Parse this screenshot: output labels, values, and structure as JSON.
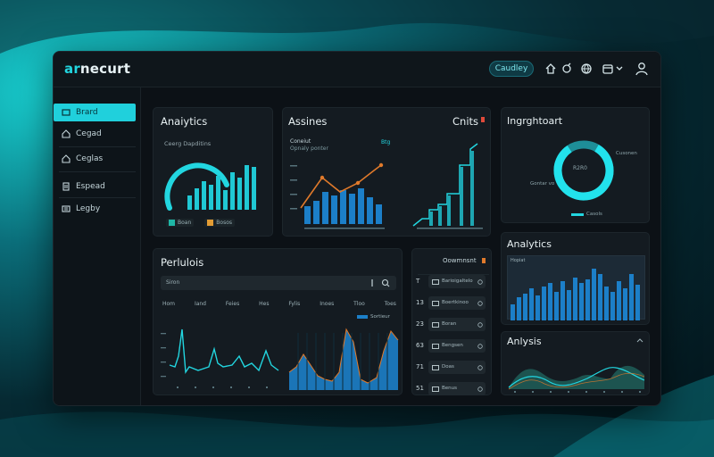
{
  "app": {
    "logo_prefix": "ar",
    "logo_suffix": "necurt",
    "top_button": "Caudley"
  },
  "sidebar": {
    "items": [
      {
        "label": "Brard",
        "icon": "dashboard-icon",
        "active": true
      },
      {
        "label": "Cegad",
        "icon": "home-icon"
      },
      {
        "label": "Ceglas",
        "icon": "home-icon"
      },
      {
        "label": "Espead",
        "icon": "document-icon"
      },
      {
        "label": "Legby",
        "icon": "list-icon"
      }
    ]
  },
  "panels": {
    "analytics_top": {
      "title": "Anaiytics",
      "subtitle": "Ceerg Dapditins",
      "legend": [
        {
          "label": "Boan",
          "color": "#1fb6a6"
        },
        {
          "label": "Bosos",
          "color": "#e39c34"
        }
      ]
    },
    "assines": {
      "title": "Assines",
      "subtitle": "Coneiut",
      "subtitle2": "Opnaly ponter",
      "badge": "Btg"
    },
    "cnits": {
      "title": "Cnits"
    },
    "ingrights": {
      "title": "Ingrghtoart",
      "center_label": "R2R0",
      "label_right": "Cusonen",
      "label_left": "Gontar vo",
      "legend": "Casols"
    },
    "perlulois": {
      "title": "Perlulois",
      "filter": "Siron",
      "columns": [
        "Hom",
        "Iand",
        "Feies",
        "Hes",
        "Fylis",
        "Inoes",
        "Tloo",
        "Toes"
      ],
      "legend": "Sortieur"
    },
    "list_panel": {
      "title": "Oowmnsnt",
      "rows": [
        {
          "num": "T",
          "label": "Barioigaltelo"
        },
        {
          "num": "13",
          "label": "Boertkinoo"
        },
        {
          "num": "23",
          "label": "Boran"
        },
        {
          "num": "63",
          "label": "Bengsen"
        },
        {
          "num": "71",
          "label": "Doas"
        },
        {
          "num": "51",
          "label": "Benus"
        }
      ]
    },
    "analytics_right": {
      "title": "Analytics",
      "subtitle": "Hopiat"
    },
    "analysis": {
      "title": "Anlysis"
    }
  },
  "colors": {
    "accent": "#20d4df",
    "bar_blue": "#1c7fc8",
    "orange": "#e07a2b",
    "panel": "#141b21"
  }
}
